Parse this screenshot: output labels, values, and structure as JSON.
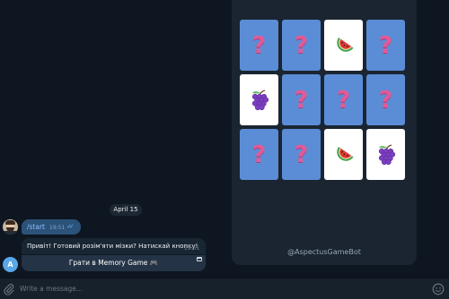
{
  "game": {
    "cards": [
      {
        "state": "down",
        "icon": "question-mark",
        "glyph": "?"
      },
      {
        "state": "down",
        "icon": "question-mark",
        "glyph": "?"
      },
      {
        "state": "up",
        "icon": "watermelon"
      },
      {
        "state": "down",
        "icon": "question-mark",
        "glyph": "?"
      },
      {
        "state": "up",
        "icon": "grapes"
      },
      {
        "state": "down",
        "icon": "question-mark",
        "glyph": "?"
      },
      {
        "state": "down",
        "icon": "question-mark",
        "glyph": "?"
      },
      {
        "state": "down",
        "icon": "question-mark",
        "glyph": "?"
      },
      {
        "state": "down",
        "icon": "question-mark",
        "glyph": "?"
      },
      {
        "state": "down",
        "icon": "question-mark",
        "glyph": "?"
      },
      {
        "state": "up",
        "icon": "watermelon"
      },
      {
        "state": "up",
        "icon": "grapes"
      }
    ],
    "bot_handle": "@AspectusGameBot"
  },
  "chat": {
    "date_divider": "April 15",
    "outgoing": {
      "text": "/start",
      "time": "19:51",
      "status_icon": "double-check-icon"
    },
    "bot_avatar_letter": "A",
    "incoming": {
      "text": "Привіт! Готовий розім'яти мізки? Натискай кнопку!",
      "time": "19:51",
      "button_label": "Грати в Memory Game 🎮"
    }
  },
  "composer": {
    "placeholder": "Write a message..."
  },
  "colors": {
    "background": "#0e1621",
    "card_back": "#5b8dd6",
    "card_face": "#ffffff",
    "question_mark": "#e35a96",
    "outgoing_bubble": "#2b5278",
    "incoming_bubble": "#182533"
  }
}
